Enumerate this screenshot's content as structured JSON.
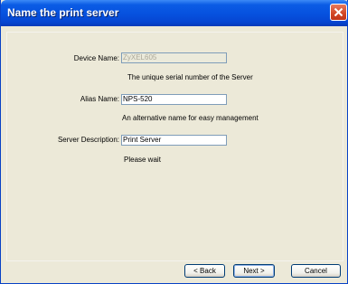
{
  "window": {
    "title": "Name the print server"
  },
  "device_name": {
    "label": "Device Name:",
    "value": "ZyXEL605",
    "hint": "The unique serial number of the Server"
  },
  "alias_name": {
    "label": "Alias Name:",
    "value": "NPS-520",
    "hint": "An alternative name for easy management"
  },
  "server_description": {
    "label": "Server Description:",
    "value": "Print Server"
  },
  "status": {
    "text": "Please wait"
  },
  "buttons": {
    "back": "< Back",
    "next": "Next >",
    "cancel": "Cancel"
  }
}
